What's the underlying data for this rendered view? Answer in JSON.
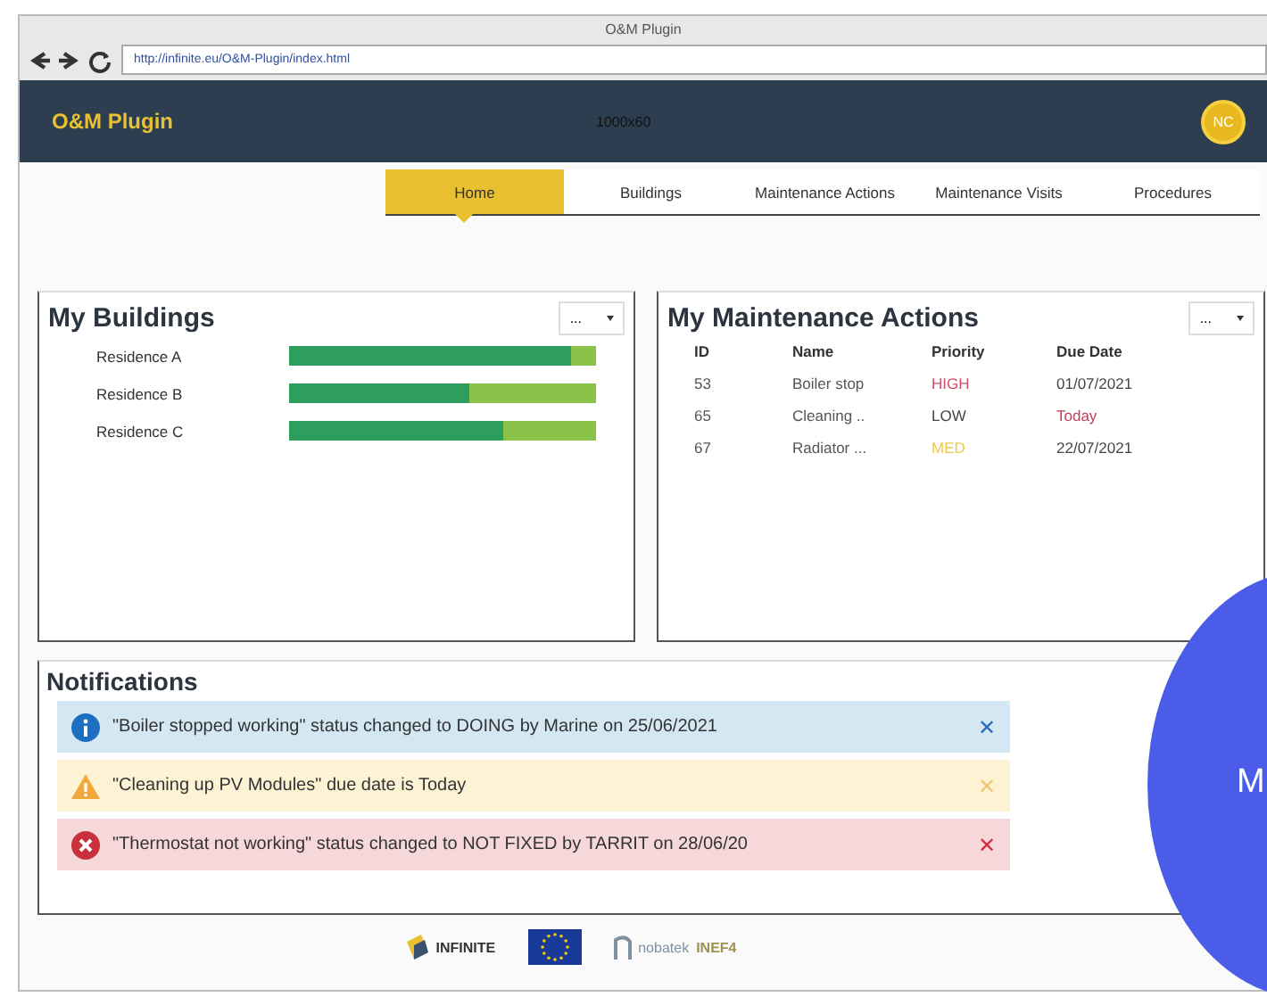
{
  "window": {
    "title": "O&M Plugin",
    "url": "http://infinite.eu/O&M-Plugin/index.html"
  },
  "header": {
    "app_name": "O&M Plugin",
    "center_text": "1000x60",
    "avatar": "NC"
  },
  "tabs": [
    {
      "label": "Home",
      "selected": true
    },
    {
      "label": "Buildings",
      "selected": false
    },
    {
      "label": "Maintenance Actions",
      "selected": false
    },
    {
      "label": "Maintenance Visits",
      "selected": false
    },
    {
      "label": "Procedures",
      "selected": false
    }
  ],
  "buildings": {
    "title": "My Buildings",
    "menu": "...",
    "rows": [
      {
        "name": "Residence A",
        "level": 0.92
      },
      {
        "name": "Residence B",
        "level": 0.59
      },
      {
        "name": "Residence C",
        "level": 0.7
      }
    ]
  },
  "actions": {
    "title": "My Maintenance Actions",
    "menu": "...",
    "columns": [
      "ID",
      "Name",
      "Priority",
      "Due Date"
    ],
    "rows": [
      {
        "id": "53",
        "name": "Boiler stop",
        "priority": {
          "text": "HIGH",
          "color": "#d0506a"
        },
        "due": {
          "text": "01/07/2021",
          "color": "#444444"
        }
      },
      {
        "id": "65",
        "name": "Cleaning ..",
        "priority": {
          "text": "LOW",
          "color": "#444444"
        },
        "due": {
          "text": "Today",
          "color": "#c0405a"
        }
      },
      {
        "id": "67",
        "name": "Radiator ...",
        "priority": {
          "text": "MED",
          "color": "#f0c84a"
        },
        "due": {
          "text": "22/07/2021",
          "color": "#444444"
        }
      }
    ]
  },
  "notifications": {
    "title": "Notifications",
    "items": [
      {
        "kind": "info",
        "text": "\"Boiler stopped working\" status changed to DOING by Marine on 25/06/2021",
        "close": "✕"
      },
      {
        "kind": "warning",
        "text": "\"Cleaning up PV Modules\" due date is Today",
        "close": "✕"
      },
      {
        "kind": "error",
        "text": "\"Thermostat not working\" status changed to NOT FIXED by TARRIT on 28/06/20",
        "close": "✕"
      }
    ]
  },
  "footer": {
    "logo_1": "INFINITE",
    "logo_3": "nobatek",
    "logo_4": "INEF4"
  },
  "overlay": {
    "letter": "M"
  }
}
